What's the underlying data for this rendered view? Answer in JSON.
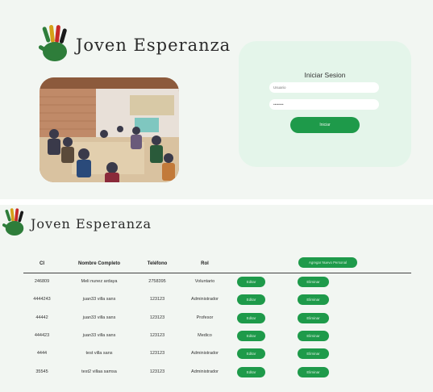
{
  "brand": {
    "name": "Joven Esperanza"
  },
  "login": {
    "title": "Iniciar Sesion",
    "username_placeholder": "Usuario",
    "password_placeholder": "••••••••",
    "submit_label": "Iniciar"
  },
  "table": {
    "headers": {
      "ci": "CI",
      "name": "Nombre Completo",
      "phone": "Teléfono",
      "role": "Rol"
    },
    "add_label": "Agregar Nuevo Personal",
    "edit_label": "Editar",
    "delete_label": "Eliminar",
    "rows": [
      {
        "ci": "246809",
        "name": "Meli nunez ardaya",
        "phone": "2758395",
        "role": "Voluntario"
      },
      {
        "ci": "4444243",
        "name": "juan33 villa sans",
        "phone": "123123",
        "role": "Administrador"
      },
      {
        "ci": "44442",
        "name": "juan33 villa sans",
        "phone": "123123",
        "role": "Profesor"
      },
      {
        "ci": "444423",
        "name": "juan33 villa sans",
        "phone": "123123",
        "role": "Medico"
      },
      {
        "ci": "4444",
        "name": "test villa sans",
        "phone": "123123",
        "role": "Administrador"
      },
      {
        "ci": "35545",
        "name": "test2 villaa samsa",
        "phone": "123123",
        "role": "Administrador"
      }
    ]
  },
  "colors": {
    "accent": "#1e9a4a",
    "panel": "#f2f6f2",
    "card": "#e4f5ea"
  }
}
